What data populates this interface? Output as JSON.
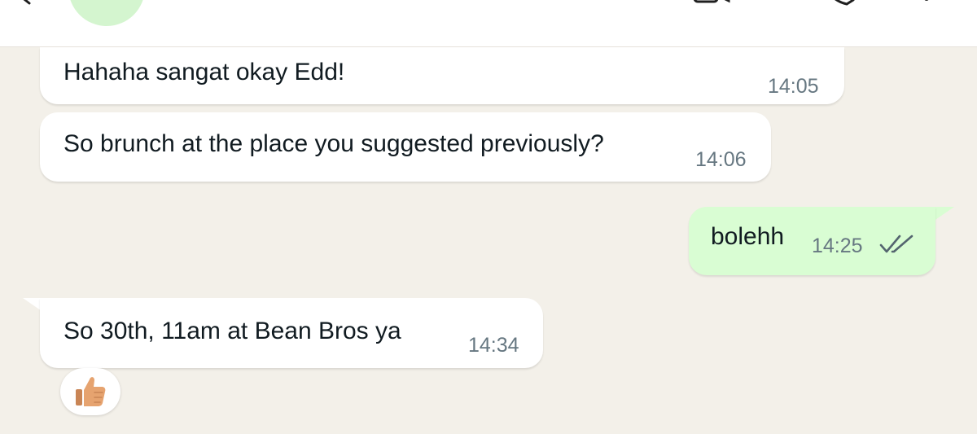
{
  "messages": [
    {
      "text": "Hahaha sangat okay Edd!",
      "time": "14:05",
      "direction": "incoming"
    },
    {
      "text": "So brunch at the place you suggested previously?",
      "time": "14:06",
      "direction": "incoming"
    },
    {
      "text": "bolehh",
      "time": "14:25",
      "direction": "outgoing",
      "status": "read"
    },
    {
      "text": "So 30th, 11am at Bean Bros ya",
      "time": "14:34",
      "direction": "incoming",
      "reaction": "thumbs-up"
    }
  ],
  "colors": {
    "chat_background": "#f3f0e9",
    "incoming_bubble": "#ffffff",
    "outgoing_bubble": "#d9fdd3",
    "avatar": "#d4f5cf",
    "text": "#111b21",
    "time": "#667781"
  },
  "icons": {
    "header_left": "back-arrow-icon",
    "header_right": [
      "video-call-icon",
      "voice-call-icon",
      "more-options-icon"
    ],
    "read_receipt": "double-check-icon",
    "reaction": "thumbs-up-icon"
  }
}
